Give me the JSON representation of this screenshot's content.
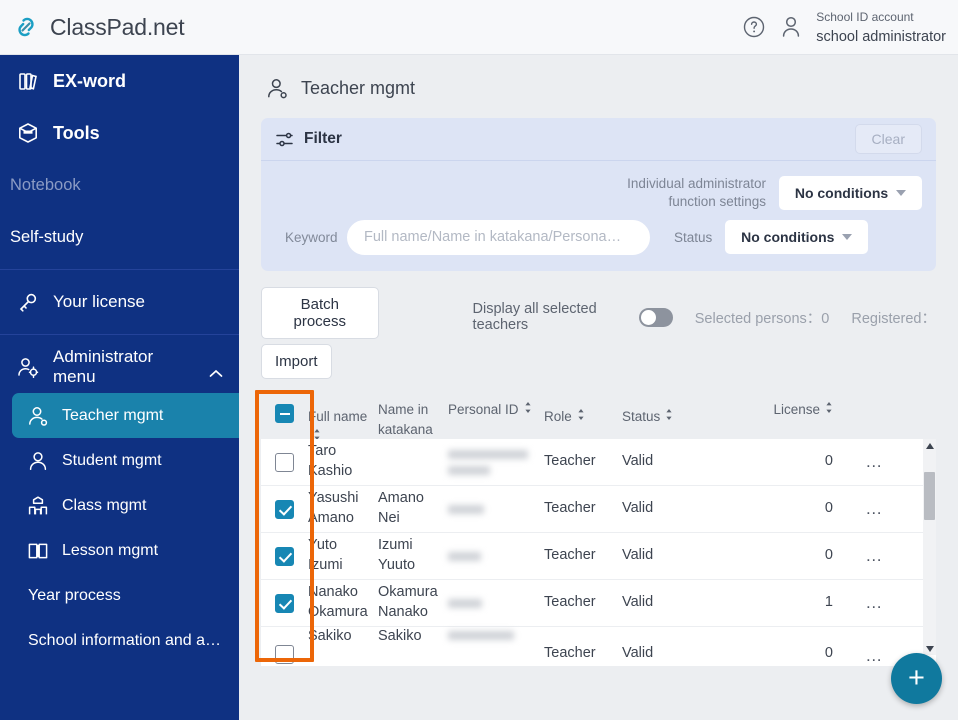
{
  "topbar": {
    "logo_icon": "chain-link-logo-icon",
    "brand": "ClassPad.net",
    "help_icon": "help-circle-icon",
    "person_icon": "person-icon",
    "account_label": "School ID account",
    "account_name": "school administrator"
  },
  "sidebar": {
    "items": [
      {
        "label": "EX-word",
        "icon": "books-icon",
        "type": "big"
      },
      {
        "label": "Tools",
        "icon": "toolbox-icon",
        "type": "big"
      },
      {
        "label": "Notebook",
        "icon": "none",
        "type": "muted"
      },
      {
        "label": "Self-study",
        "icon": "none",
        "type": "plain"
      },
      {
        "label": "Your license",
        "icon": "key-icon",
        "type": "icon"
      },
      {
        "label": "Administrator menu",
        "icon": "admin-user-icon",
        "type": "section",
        "expanded": true,
        "chevron": "chevron-up-icon"
      }
    ],
    "admin_items": [
      {
        "label": "Teacher mgmt",
        "icon": "teacher-icon",
        "active": true
      },
      {
        "label": "Student mgmt",
        "icon": "student-icon",
        "active": false
      },
      {
        "label": "Class mgmt",
        "icon": "class-icon",
        "active": false
      },
      {
        "label": "Lesson mgmt",
        "icon": "book-open-icon",
        "active": false
      },
      {
        "label": "Year process",
        "icon": "none",
        "active": false
      },
      {
        "label": "School information and a…",
        "icon": "none",
        "active": false
      }
    ],
    "active_color": "#1a82ab",
    "background": "#0f3182"
  },
  "page": {
    "title": "Teacher mgmt",
    "title_icon": "teacher-icon"
  },
  "filter": {
    "icon": "tune-sliders-icon",
    "title": "Filter",
    "clear_label": "Clear",
    "clear_disabled": true,
    "admin_function_label_line1": "Individual administrator",
    "admin_function_label_line2": "function settings",
    "admin_function_value": "No conditions",
    "keyword_label": "Keyword",
    "keyword_value": "",
    "keyword_placeholder": "Full name/Name in katakana/Persona…",
    "status_label": "Status",
    "status_value": "No conditions",
    "caret_icon": "chevron-down-icon"
  },
  "toolbar": {
    "batch_process_label": "Batch process",
    "import_label": "Import",
    "display_all_label": "Display all selected teachers",
    "toggle_on": false,
    "selected_persons_text": "Selected persons：0",
    "registered_text": "Registered："
  },
  "table": {
    "header_checkbox_state": "indeterminate",
    "columns": [
      {
        "label": "Full name",
        "sortable": true
      },
      {
        "label": "Name in katakana",
        "sortable": true
      },
      {
        "label": "Personal ID",
        "sortable": true
      },
      {
        "label": "Role",
        "sortable": true
      },
      {
        "label": "Status",
        "sortable": true
      },
      {
        "label": "License",
        "sortable": true
      }
    ],
    "rows": [
      {
        "checked": false,
        "full_name": "Taro Kashio",
        "kana": "",
        "personal_id": "",
        "personal_id_redacted": true,
        "role": "Teacher",
        "status": "Valid",
        "license": "0",
        "more": "…"
      },
      {
        "checked": true,
        "full_name": "Yasushi Amano",
        "kana": "Amano Nei",
        "personal_id": "",
        "personal_id_redacted": true,
        "role": "Teacher",
        "status": "Valid",
        "license": "0",
        "more": "…"
      },
      {
        "checked": true,
        "full_name": "Yuto Izumi",
        "kana": "Izumi Yuuto",
        "personal_id": "",
        "personal_id_redacted": true,
        "role": "Teacher",
        "status": "Valid",
        "license": "0",
        "more": "…"
      },
      {
        "checked": true,
        "full_name": "Nanako Okamura",
        "kana": "Okamura Nanako",
        "personal_id": "",
        "personal_id_redacted": true,
        "role": "Teacher",
        "status": "Valid",
        "license": "1",
        "more": "…"
      },
      {
        "checked": false,
        "full_name": "Sakiko",
        "kana": "Sakiko",
        "personal_id": "",
        "personal_id_redacted": true,
        "role": "Teacher",
        "status": "Valid",
        "license": "0",
        "more": "…"
      }
    ]
  },
  "fab": {
    "label": "+",
    "icon": "plus-icon",
    "color": "#10799e"
  },
  "annotation": {
    "color": "#ec6608",
    "target": "checkbox-column"
  }
}
